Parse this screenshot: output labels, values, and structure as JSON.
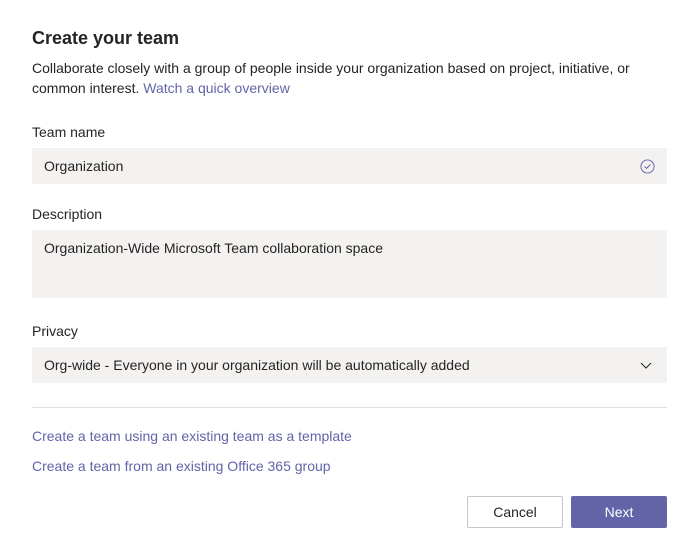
{
  "header": {
    "title": "Create your team",
    "subtitle_prefix": "Collaborate closely with a group of people inside your organization based on project, initiative, or common interest. ",
    "subtitle_link": "Watch a quick overview"
  },
  "fields": {
    "teamName": {
      "label": "Team name",
      "value": "Organization"
    },
    "description": {
      "label": "Description",
      "value": "Organization-Wide Microsoft Team collaboration space"
    },
    "privacy": {
      "label": "Privacy",
      "value": "Org-wide - Everyone in your organization will be automatically added"
    }
  },
  "altLinks": {
    "templateLink": "Create a team using an existing team as a template",
    "o365Link": "Create a team from an existing Office 365 group"
  },
  "footer": {
    "cancel": "Cancel",
    "next": "Next"
  }
}
